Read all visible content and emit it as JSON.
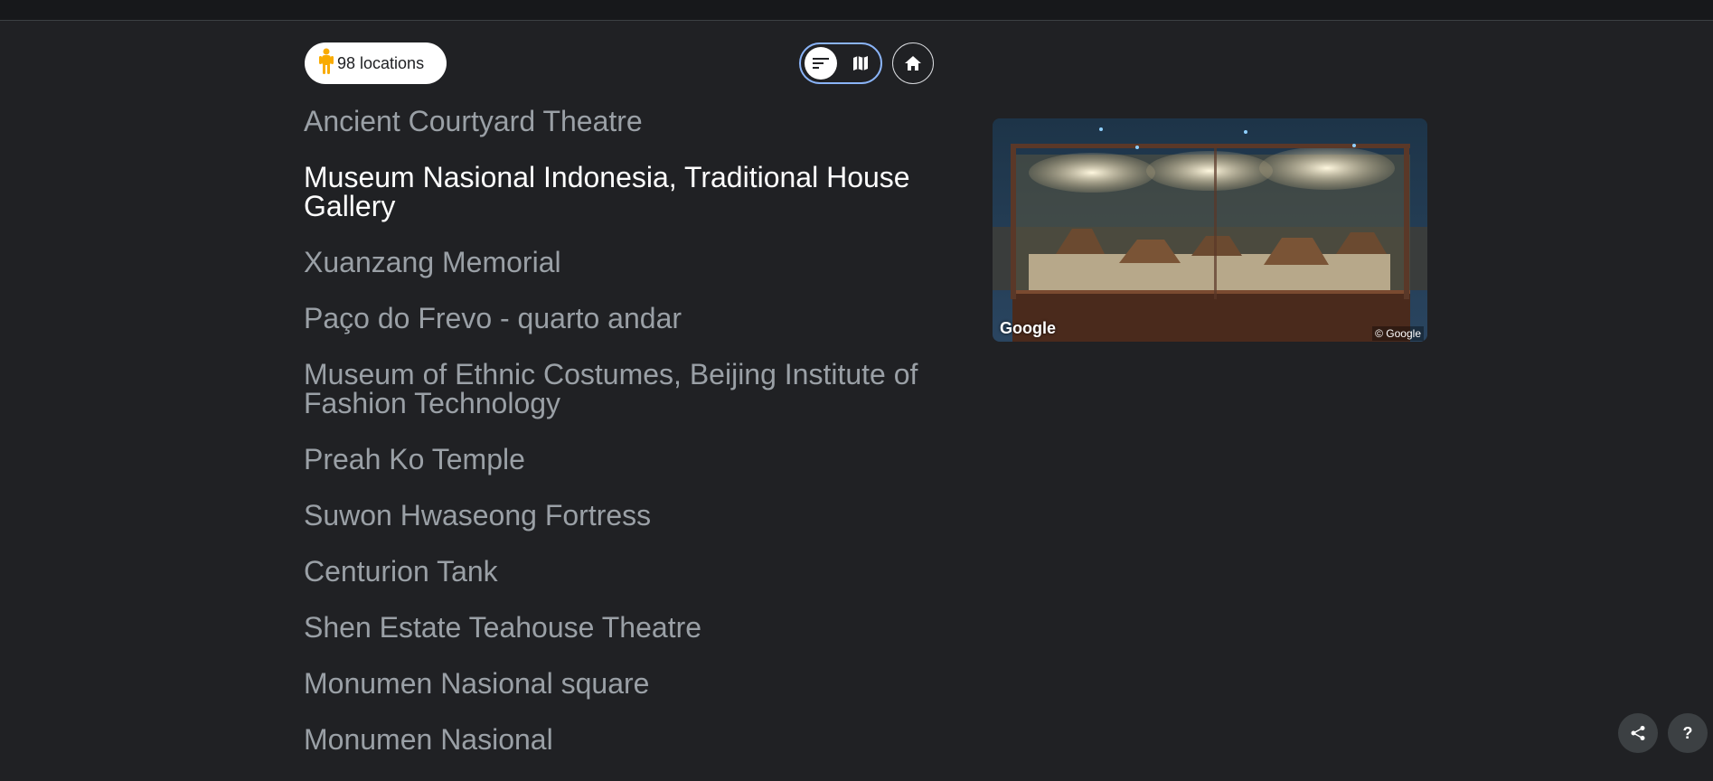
{
  "header": {
    "locations_label": "98 locations",
    "pegman_icon": "pegman-icon",
    "view_options": [
      {
        "name": "list-view",
        "icon": "list-icon",
        "active": true
      },
      {
        "name": "map-view",
        "icon": "map-icon",
        "active": false
      }
    ],
    "home_icon": "home-icon"
  },
  "locations": [
    {
      "label": "Ancient Courtyard Theatre",
      "active": false
    },
    {
      "label": "Museum Nasional Indonesia, Traditional House Gallery",
      "active": true
    },
    {
      "label": "Xuanzang Memorial",
      "active": false
    },
    {
      "label": "Paço do Frevo - quarto andar",
      "active": false
    },
    {
      "label": "Museum of Ethnic Costumes, Beijing Institute of Fashion Technology",
      "active": false
    },
    {
      "label": "Preah Ko Temple",
      "active": false
    },
    {
      "label": "Suwon Hwaseong Fortress",
      "active": false
    },
    {
      "label": "Centurion Tank",
      "active": false
    },
    {
      "label": "Shen Estate Teahouse Theatre",
      "active": false
    },
    {
      "label": "Monumen Nasional square",
      "active": false
    },
    {
      "label": "Monumen Nasional",
      "active": false
    }
  ],
  "preview": {
    "logo": "Google",
    "copyright": "© Google"
  },
  "footer": {
    "share_icon": "share-icon",
    "help_label": "?"
  },
  "colors": {
    "background": "#202124",
    "accent": "#8ab4f8",
    "pegman": "#f9ab00"
  }
}
